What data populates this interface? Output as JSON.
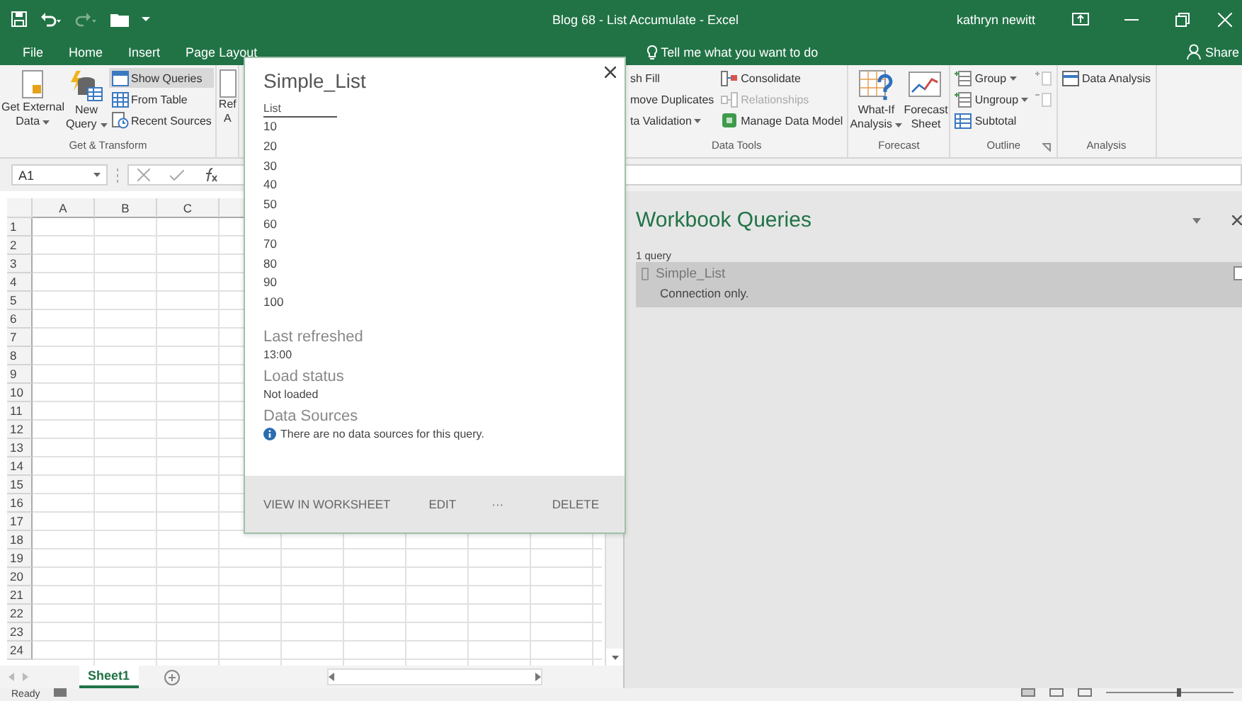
{
  "title_bar": {
    "title": "Blog 68 - List Accumulate - Excel",
    "user": "kathryn newitt"
  },
  "menu_tabs": [
    {
      "label": "File",
      "selected": false
    },
    {
      "label": "Home",
      "selected": false
    },
    {
      "label": "Insert",
      "selected": false
    },
    {
      "label": "Page Layout",
      "selected": false
    }
  ],
  "tell_me": {
    "placeholder": "Tell me what you want to do"
  },
  "share": "Share",
  "ribbon_left": [
    {
      "label": "Get & Transform",
      "columns": [
        {
          "kind": "large",
          "lines": [
            "Get External",
            "Data"
          ],
          "dropdown": true
        },
        {
          "kind": "large",
          "lines": [
            "New",
            "Query"
          ],
          "dropdown": true
        },
        {
          "kind": "stack",
          "items": [
            {
              "kind": "text",
              "label": "Show Queries",
              "on": true,
              "disabled": false
            },
            {
              "kind": "text",
              "label": "From Table",
              "on": false,
              "disabled": false
            },
            {
              "kind": "text",
              "label": "Recent Sources",
              "on": false,
              "disabled": false
            }
          ]
        }
      ]
    },
    {
      "columns": [
        {
          "kind": "large",
          "lines": [
            "Ref",
            "A"
          ]
        }
      ]
    }
  ],
  "ribbon_right": [
    {
      "label": "Data Tools",
      "columns": [
        {
          "kind": "stack",
          "cut": true,
          "items": [
            {
              "kind": "text",
              "label": "sh Fill",
              "on": false,
              "disabled": false
            },
            {
              "kind": "text",
              "label": "move Duplicates",
              "on": false,
              "disabled": false
            },
            {
              "kind": "text",
              "label": "ta Validation",
              "dropdown": true,
              "on": false,
              "disabled": false
            }
          ]
        },
        {
          "kind": "stack",
          "items": [
            {
              "kind": "text",
              "label": "Consolidate",
              "on": false,
              "disabled": false
            },
            {
              "kind": "text",
              "label": "Relationships",
              "on": false,
              "disabled": true
            },
            {
              "kind": "text",
              "label": "Manage Data Model",
              "on": false,
              "disabled": false
            }
          ]
        }
      ]
    },
    {
      "label": "Forecast",
      "columns": [
        {
          "kind": "large",
          "lines": [
            "What-If",
            "Analysis"
          ],
          "dropdown": true
        },
        {
          "kind": "large",
          "lines": [
            "Forecast",
            "Sheet"
          ]
        }
      ]
    },
    {
      "label": "Outline",
      "launcher": true,
      "columns": [
        {
          "kind": "stack",
          "items": [
            {
              "kind": "text",
              "label": "Group",
              "dropdown": true,
              "on": false,
              "disabled": false
            },
            {
              "kind": "text",
              "label": "Ungroup",
              "dropdown": true,
              "on": false,
              "disabled": false
            },
            {
              "kind": "text",
              "label": "Subtotal",
              "on": false,
              "disabled": false
            }
          ]
        },
        {
          "kind": "stack",
          "items": [
            {
              "kind": "icon",
              "disabled": true
            },
            {
              "kind": "icon",
              "disabled": true
            }
          ]
        }
      ]
    },
    {
      "label": "Analysis",
      "columns": [
        {
          "kind": "stack",
          "items": [
            {
              "kind": "text",
              "label": "Data Analysis",
              "on": false,
              "disabled": false
            }
          ]
        }
      ]
    }
  ],
  "formula_bar": {
    "name_box": "A1"
  },
  "grid": {
    "columns": [
      "A",
      "B",
      "C"
    ],
    "rows": [
      "1",
      "2",
      "3",
      "4",
      "5",
      "6",
      "7",
      "8",
      "9",
      "10",
      "11",
      "12",
      "13",
      "14",
      "15",
      "16",
      "17",
      "18",
      "19",
      "20",
      "21",
      "22",
      "23",
      "24"
    ]
  },
  "sheet_tabs": [
    {
      "label": "Sheet1",
      "selected": true
    }
  ],
  "status_bar": {
    "text": "Ready"
  },
  "queries_pane": {
    "title": "Workbook Queries",
    "count": "1 query",
    "queries": [
      {
        "name": "Simple_List",
        "status": "Connection only.",
        "selected": true
      }
    ]
  },
  "preview": {
    "title": "Simple_List",
    "column": "List",
    "values": [
      "10",
      "20",
      "30",
      "40",
      "50",
      "60",
      "70",
      "80",
      "90",
      "100"
    ],
    "sections": [
      {
        "kind": "text",
        "heading": "Last refreshed",
        "value": "13:00"
      },
      {
        "kind": "text",
        "heading": "Load status",
        "value": "Not loaded"
      },
      {
        "kind": "info",
        "heading": "Data Sources",
        "value": "There are no data sources for this query."
      }
    ],
    "actions": [
      "VIEW IN WORKSHEET",
      "EDIT",
      "···",
      "DELETE"
    ]
  }
}
